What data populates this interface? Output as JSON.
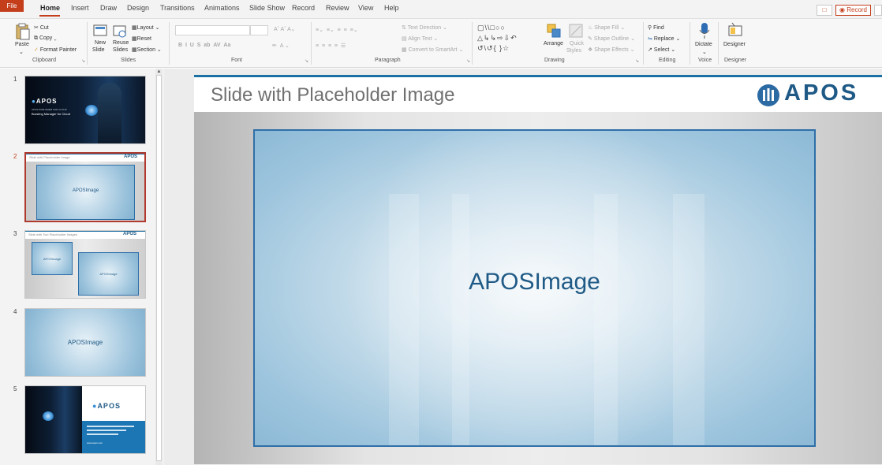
{
  "tabs": {
    "file": "File",
    "home": "Home",
    "insert": "Insert",
    "draw": "Draw",
    "design": "Design",
    "transitions": "Transitions",
    "animations": "Animations",
    "slide_show": "Slide Show",
    "record": "Record",
    "review": "Review",
    "view": "View",
    "help": "Help"
  },
  "top_right": {
    "record_button": "Record"
  },
  "ribbon": {
    "clipboard": {
      "paste": "Paste",
      "cut": "Cut",
      "copy": "Copy",
      "format_painter": "Format Painter",
      "label": "Clipboard"
    },
    "slides": {
      "new_slide_1": "New",
      "new_slide_2": "Slide",
      "reuse_1": "Reuse",
      "reuse_2": "Slides",
      "layout": "Layout",
      "reset": "Reset",
      "section": "Section",
      "label": "Slides"
    },
    "font": {
      "label": "Font"
    },
    "paragraph": {
      "text_direction": "Text Direction",
      "align_text": "Align Text",
      "convert_smartart": "Convert to SmartArt",
      "label": "Paragraph"
    },
    "drawing": {
      "arrange": "Arrange",
      "quick_styles_1": "Quick",
      "quick_styles_2": "Styles",
      "shape_fill": "Shape Fill",
      "shape_outline": "Shape Outline",
      "shape_effects": "Shape Effects",
      "label": "Drawing"
    },
    "editing": {
      "find": "Find",
      "replace": "Replace",
      "select": "Select",
      "label": "Editing"
    },
    "voice": {
      "dictate": "Dictate",
      "label": "Voice"
    },
    "designer": {
      "designer": "Designer",
      "label": "Designer"
    }
  },
  "thumbnails": [
    {
      "number": "1",
      "brand": "APOS",
      "subtitle": "APOS PUBLISHER FOR CLOUD",
      "title": "Bursting Manager for Cloud"
    },
    {
      "number": "2",
      "header": "Slide with Placeholder Image",
      "brand": "APOS",
      "placeholder": "APOSImage",
      "selected": true
    },
    {
      "number": "3",
      "header": "Slide with Two Placeholder Images",
      "brand": "APOS",
      "placeholder_a": "APOSImage",
      "placeholder_b": "APOSImage"
    },
    {
      "number": "4",
      "placeholder": "APOSImage"
    },
    {
      "number": "5",
      "brand": "APOS",
      "footer": "www.apos.com"
    }
  ],
  "slide": {
    "title": "Slide with Placeholder Image",
    "logo_text": "APOS",
    "placeholder_text": "APOSImage",
    "accent_color": "#1a6fa3",
    "brand_color": "#1f5a86"
  }
}
